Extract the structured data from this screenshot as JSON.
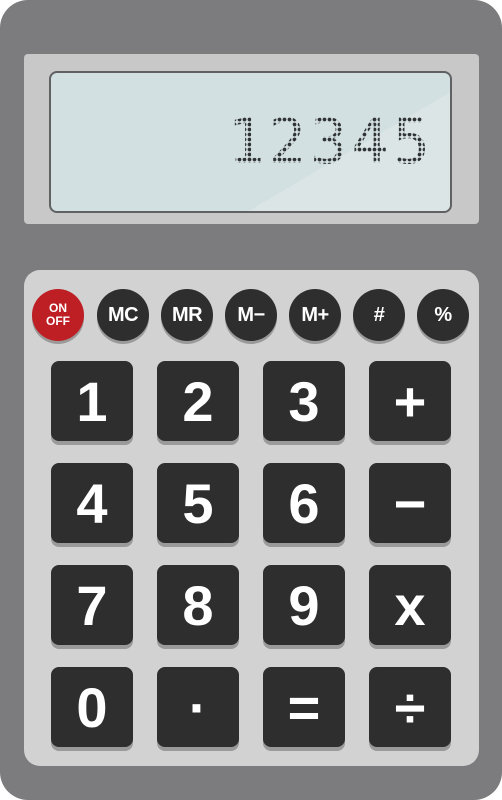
{
  "display": {
    "value": "12345"
  },
  "round_keys": [
    {
      "line1": "ON",
      "line2": "OFF",
      "color": "#bd1f25"
    },
    {
      "label": "MC"
    },
    {
      "label": "MR"
    },
    {
      "label": "M−"
    },
    {
      "label": "M+"
    },
    {
      "label": "#"
    },
    {
      "label": "%"
    }
  ],
  "keys": {
    "rows": [
      [
        "1",
        "2",
        "3",
        "+"
      ],
      [
        "4",
        "5",
        "6",
        "−"
      ],
      [
        "7",
        "8",
        "9",
        "x"
      ],
      [
        "0",
        "·",
        "=",
        "÷"
      ]
    ]
  },
  "colors": {
    "body": "#7c7c7e",
    "keypad": "#d2d2d2",
    "key": "#2e2e2e",
    "power_key": "#bd1f25",
    "screen": "#d3e0e1"
  }
}
